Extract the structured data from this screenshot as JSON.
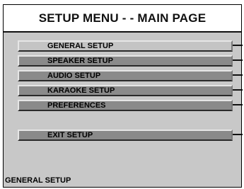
{
  "title": "SETUP MENU - - MAIN PAGE",
  "menu": {
    "items": [
      {
        "label": "GENERAL SETUP"
      },
      {
        "label": "SPEAKER SETUP"
      },
      {
        "label": "AUDIO SETUP"
      },
      {
        "label": "KARAOKE SETUP"
      },
      {
        "label": "PREFERENCES"
      }
    ],
    "exit_label": "EXIT SETUP"
  },
  "status_text": "GENERAL SETUP"
}
